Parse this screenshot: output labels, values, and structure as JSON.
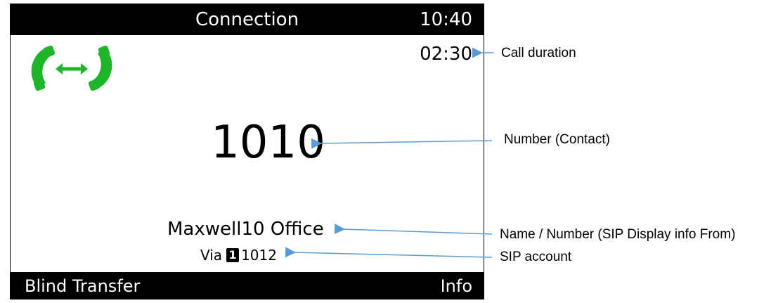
{
  "screen": {
    "title": "Connection",
    "clock": "10:40",
    "call_duration": "02:30",
    "contact_number": "1010",
    "display_name": "Maxwell10 Office",
    "via_label": "Via",
    "account_index": "1",
    "account_number": "1012",
    "icon": "call-connected-icon",
    "icon_color": "#1fb52b"
  },
  "softkeys": {
    "left": "Blind Transfer",
    "right": "Info"
  },
  "annotations": {
    "call_duration": "Call duration",
    "number": "Number (Contact)",
    "name": "Name / Number (SIP Display info From)",
    "sip_account": "SIP account",
    "arrow_color": "#5b9bd5"
  }
}
